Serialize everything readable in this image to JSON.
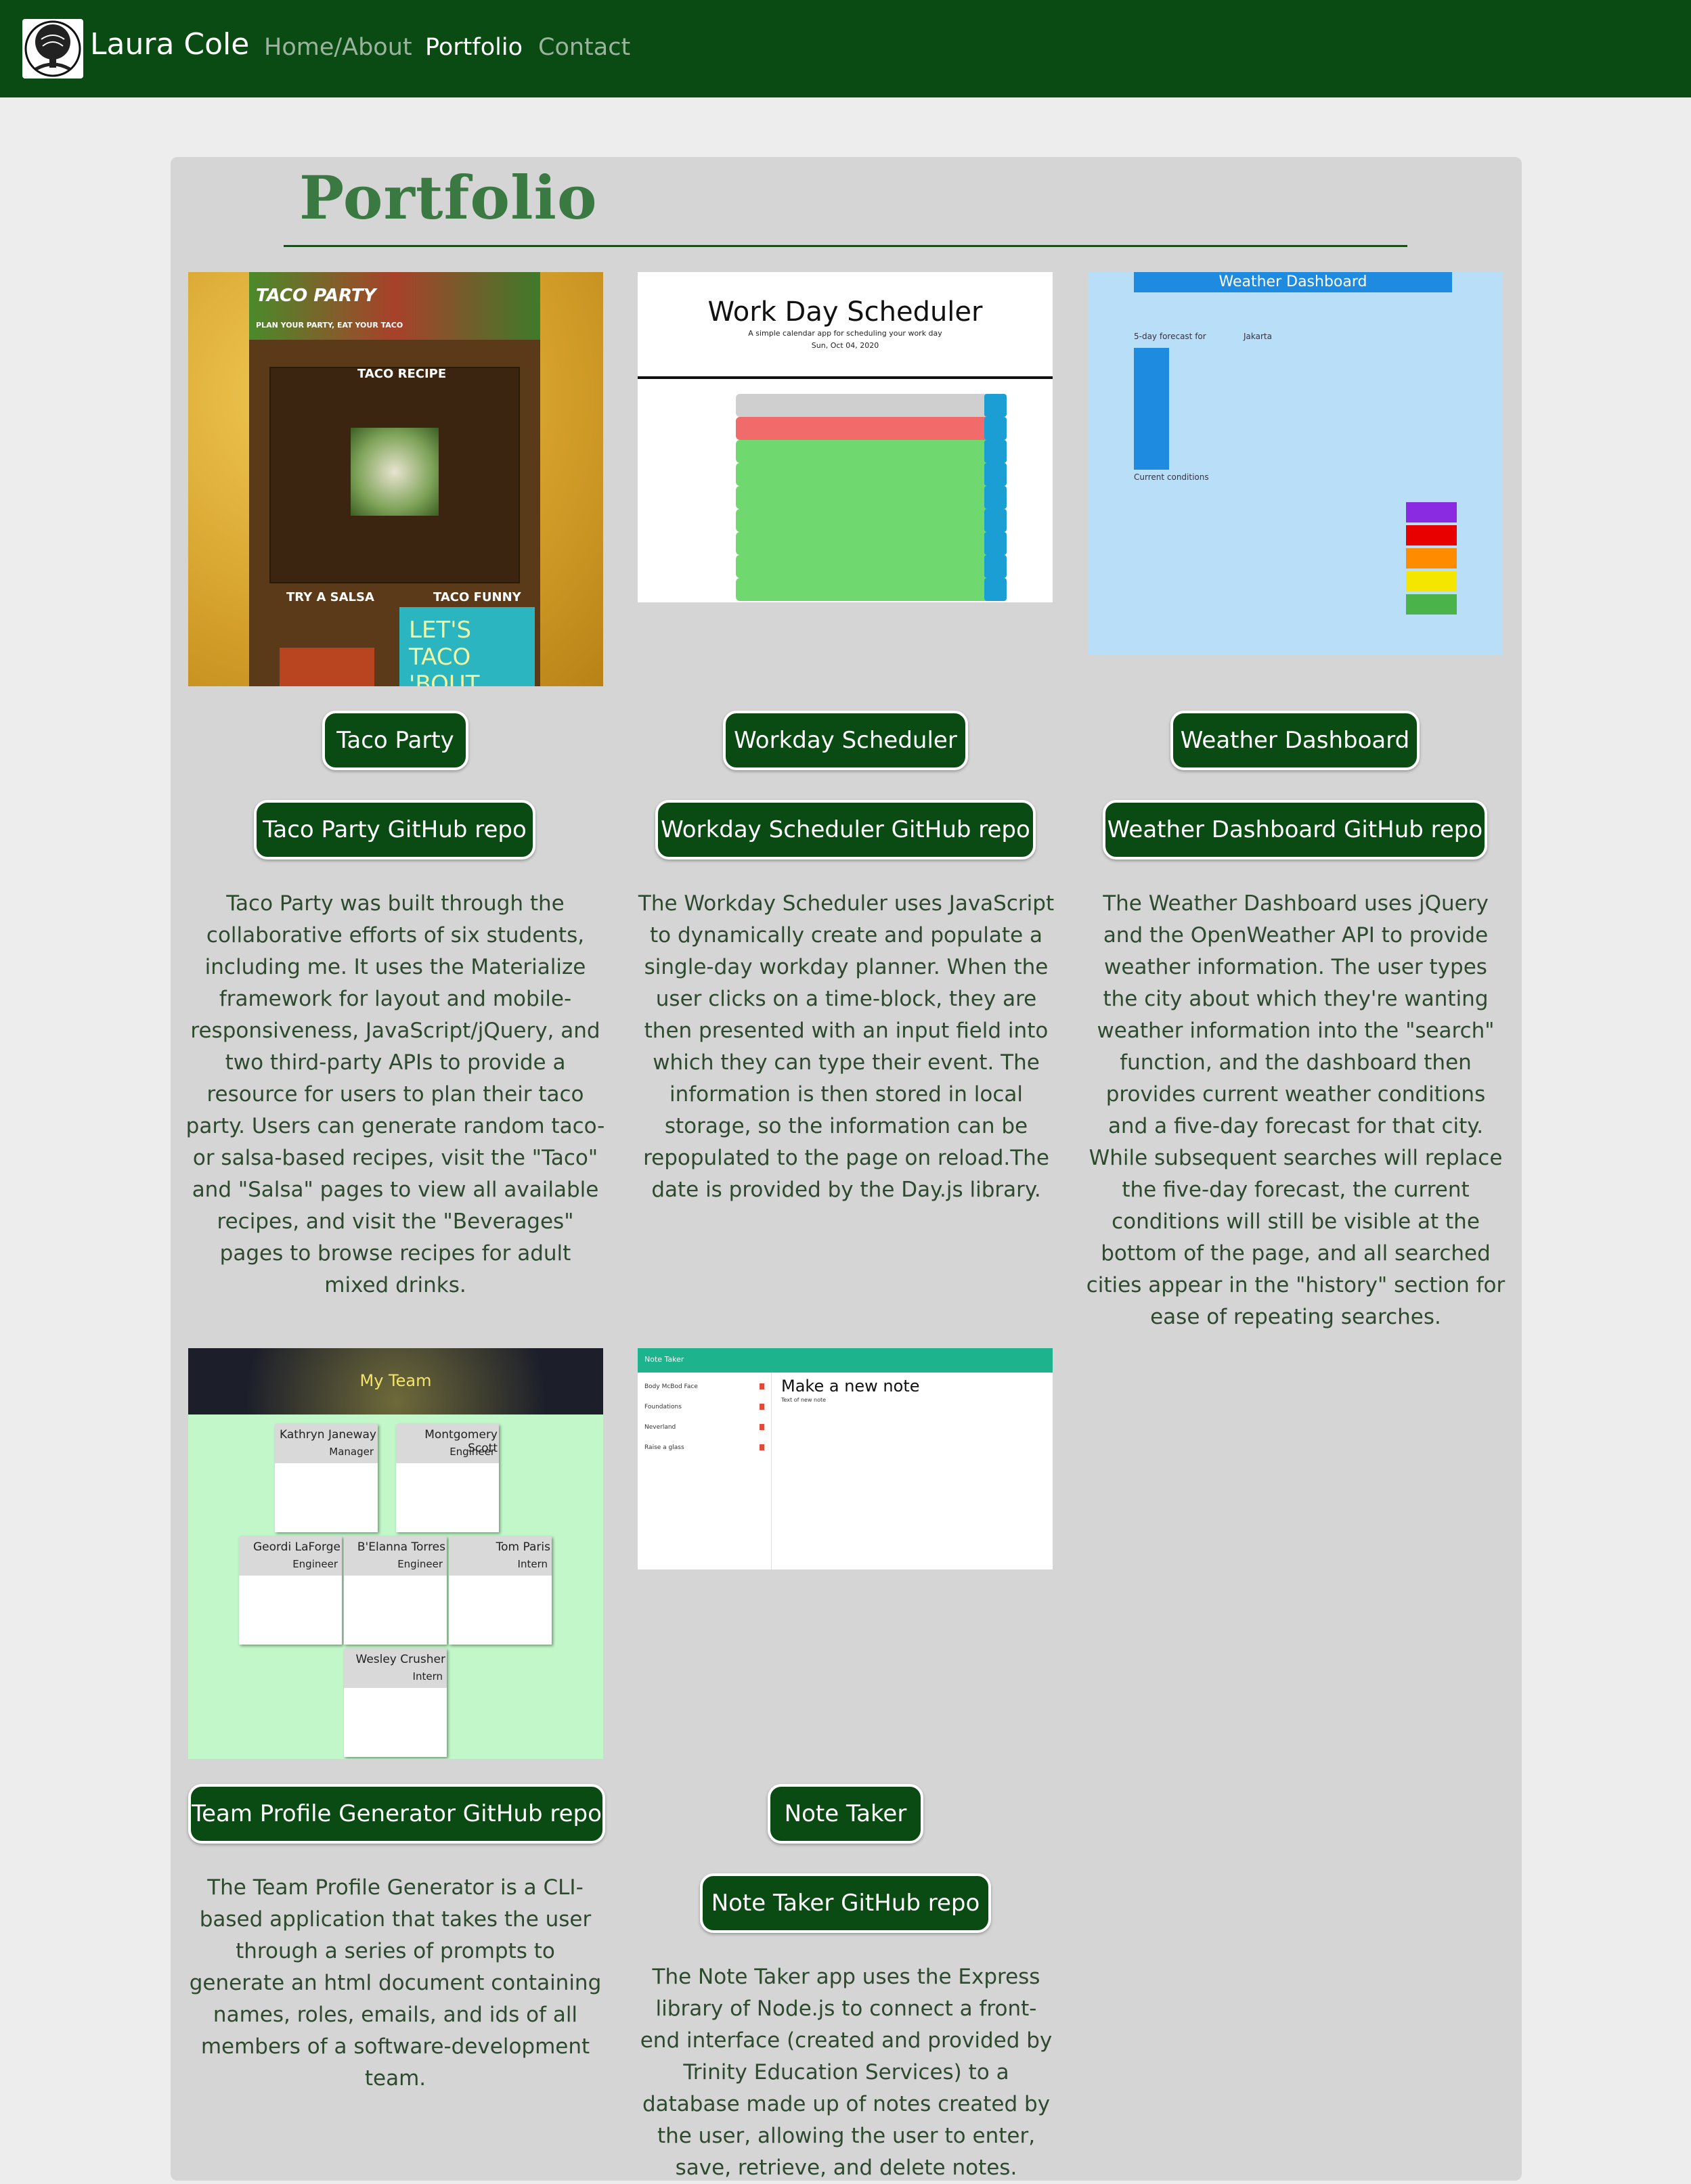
{
  "nav": {
    "brand": "Laura Cole",
    "links": [
      "Home/About",
      "Portfolio",
      "Contact"
    ]
  },
  "page": {
    "title": "Portfolio"
  },
  "projects": [
    {
      "name": "Taco Party",
      "repo_label": "Taco Party GitHub repo",
      "description": "Taco Party was built through the collaborative efforts of six students, including me. It uses the Materialize framework for layout and mobile-responsiveness, JavaScript/jQuery, and two third-party APIs to provide a resource for users to plan their taco party. Users can generate random taco- or salsa-based recipes, visit the \"Taco\" and \"Salsa\" pages to view all available recipes, and visit the \"Beverages\" pages to browse recipes for adult mixed drinks.",
      "shot": {
        "header": "TACO PARTY",
        "tagline": "PLAN YOUR PARTY, EAT YOUR TACO",
        "recipe": "TACO RECIPE",
        "salsa": "TRY A SALSA",
        "funny": "TACO FUNNY",
        "lets": "LET'S TACO 'BOUT"
      }
    },
    {
      "name": "Workday Scheduler",
      "repo_label": "Workday Scheduler GitHub repo",
      "description": "The Workday Scheduler uses JavaScript to dynamically create and populate a single-day workday planner. When the user clicks on a time-block, they are then presented with an input field into which they can type their event. The information is then stored in local storage, so the information can be repopulated to the page on reload.The date is provided by the Day.js library.",
      "shot": {
        "title": "Work Day Scheduler",
        "subtitle": "A simple calendar app for scheduling your work day",
        "date": "Sun, Oct 04, 2020"
      }
    },
    {
      "name": "Weather Dashboard",
      "repo_label": "Weather Dashboard GitHub repo",
      "description": "The Weather Dashboard uses jQuery and the OpenWeather API to provide weather information. The user types the city about which they're wanting weather information into the \"search\" function, and the dashboard then provides current weather conditions and a five-day forecast for that city. While subsequent searches will replace the five-day forecast, the current conditions will still be visible at the bottom of the page, and all searched cities appear in the \"history\" section for ease of repeating searches.",
      "shot": {
        "title": "Weather Dashboard",
        "forecast": "5-day forecast for",
        "city": "Jakarta",
        "current": "Current conditions"
      }
    },
    {
      "name": "Team Profile Generator",
      "repo_label": "Team Profile Generator GitHub repo",
      "description": "The Team Profile Generator is a CLI-based application that takes the user through a series of prompts to generate an html document containing names, roles, emails, and ids of all members of a software-development team.",
      "shot": {
        "header": "My Team",
        "members": [
          {
            "name": "Kathryn Janeway",
            "role": "Manager"
          },
          {
            "name": "Montgomery Scott",
            "role": "Engineer"
          },
          {
            "name": "Geordi LaForge",
            "role": "Engineer"
          },
          {
            "name": "B'Elanna Torres",
            "role": "Engineer"
          },
          {
            "name": "Tom Paris",
            "role": "Intern"
          },
          {
            "name": "Wesley Crusher",
            "role": "Intern"
          }
        ]
      }
    },
    {
      "name": "Note Taker",
      "repo_label": "Note Taker GitHub repo",
      "description": "The Note Taker app uses the Express library of Node.js to connect a front-end interface (created and provided by Trinity Education Services) to a database made up of notes created by the user, allowing the user to enter, save, retrieve, and delete notes.",
      "shot": {
        "bar": "Note Taker",
        "heading": "Make a new note",
        "body": "Text of new note",
        "notes": [
          "Body McBod Face",
          "Foundations",
          "Neverland",
          "Raise a glass"
        ]
      }
    }
  ],
  "colors": {
    "nav": "#0a4a13",
    "button": "#0a4a13",
    "panel": "#d5d5d5",
    "background": "#ededed"
  }
}
